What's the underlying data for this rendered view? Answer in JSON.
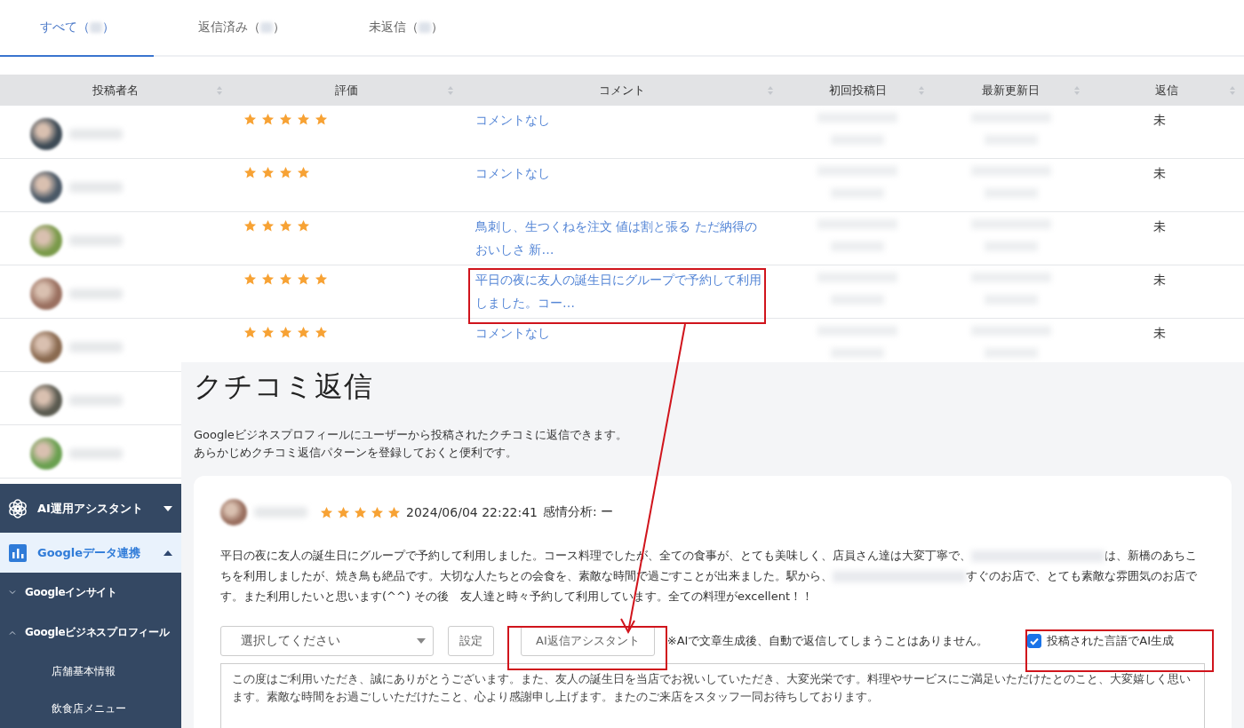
{
  "tabs": [
    {
      "label_before": "すべて（",
      "label_after": "）",
      "selected": true
    },
    {
      "label_before": "返信済み（",
      "label_after": "）",
      "selected": false
    },
    {
      "label_before": "未返信（",
      "label_after": "）",
      "selected": false
    }
  ],
  "table": {
    "columns": [
      "投稿者名",
      "評価",
      "コメント",
      "初回投稿日",
      "最新更新日",
      "返信"
    ],
    "rows": [
      {
        "stars": 5,
        "comment": "コメントなし",
        "reply": "未"
      },
      {
        "stars": 4,
        "comment": "コメントなし",
        "reply": "未"
      },
      {
        "stars": 4,
        "comment": "鳥刺し、生つくねを注文 値は割と張る ただ納得のおいしさ 新…",
        "reply": "未"
      },
      {
        "stars": 5,
        "comment": "平日の夜に友人の誕生日にグループで予約して利用しました。コー…",
        "reply": "未"
      },
      {
        "stars": 5,
        "comment": "コメントなし",
        "reply": "未"
      },
      {},
      {}
    ]
  },
  "sidebar": {
    "items": [
      {
        "label": "AI運用アシスタント",
        "kind": "section",
        "expanded": false,
        "selected": false
      },
      {
        "label": "Googleデータ連携",
        "kind": "section",
        "expanded": true,
        "selected": true,
        "children": [
          {
            "label": "Googleインサイト",
            "kind": "group",
            "expanded": false
          },
          {
            "label": "Googleビジネスプロフィール",
            "kind": "group",
            "expanded": true,
            "children": [
              {
                "label": "店舗基本情報",
                "kind": "page"
              },
              {
                "label": "飲食店メニュー",
                "kind": "page"
              }
            ]
          }
        ]
      }
    ]
  },
  "reply_page": {
    "title": "クチコミ返信",
    "description": [
      "Googleビジネスプロフィールにユーザーから投稿されたクチコミに返信できます。",
      "あらかじめクチコミ返信パターンを登録しておくと便利です。"
    ],
    "review": {
      "stars": 5,
      "datetime": "2024/06/04 22:22:41",
      "sentiment": "感情分析: ー",
      "body": [
        {
          "kind": "text",
          "text": "平日の夜に友人の誕生日にグループで予約して利用しました。コース料理でしたが、全ての食事が、とても美味しく、店員さん達は大変丁寧で、"
        },
        {
          "kind": "redacted"
        },
        {
          "kind": "text",
          "text": "は、新橋のあちこちを利用しましたが、焼き鳥も絶品です。大切な人たちとの会食を、素敵な時間で過ごすことが出来ました。駅から、"
        },
        {
          "kind": "redacted"
        },
        {
          "kind": "text",
          "text": "すぐのお店で、とても素敵な雰囲気のお店です。また利用したいと思います(^^) その後　友人達と時々予約して利用しています。全ての料理がexcellent！！"
        }
      ]
    },
    "template_select": {
      "placeholder": "選択してください"
    },
    "settings_button": "設定",
    "ai_button": "AI返信アシスタント",
    "note": "※AIで文章生成後、自動で返信してしまうことはありません。",
    "language_checkbox": {
      "label": "投稿された言語でAI生成",
      "checked": true
    },
    "reply_text": "この度はご利用いただき、誠にありがとうございます。また、友人の誕生日を当店でお祝いしていただき、大変光栄です。料理やサービスにご満足いただけたとのこと、大変嬉しく思います。素敵な時間をお過ごしいただけたこと、心より感謝申し上げます。またのご来店をスタッフ一同お待ちしております。"
  }
}
